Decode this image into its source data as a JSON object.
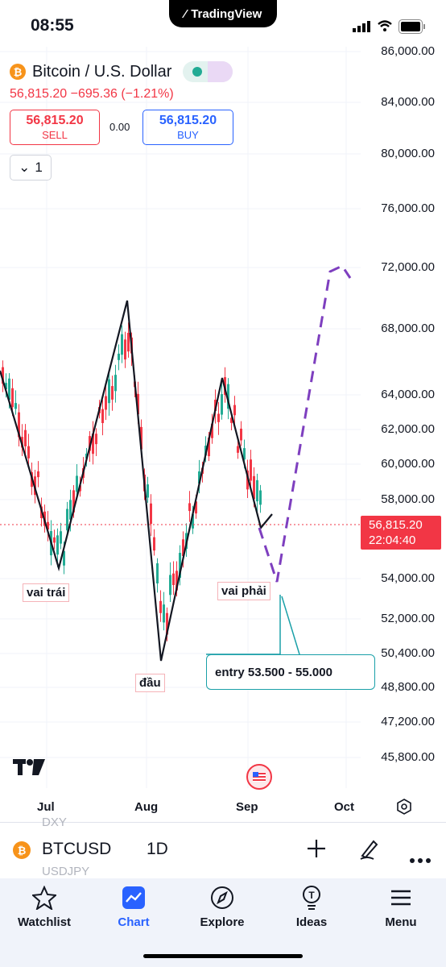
{
  "status_bar": {
    "time": "08:55",
    "app_pill": "TradingView"
  },
  "symbol": {
    "name": "Bitcoin / U.S. Dollar",
    "price_line": "56,815.20 −695.36 (−1.21%)",
    "sell_value": "56,815.20",
    "sell_label": "SELL",
    "spread": "0.00",
    "buy_value": "56,815.20",
    "buy_label": "BUY",
    "collapse_count": "1",
    "btc_glyph": "₿"
  },
  "y_axis": [
    {
      "label": "86,000.00",
      "value": 86000
    },
    {
      "label": "84,000.00",
      "value": 84000
    },
    {
      "label": "80,000.00",
      "value": 80000
    },
    {
      "label": "76,000.00",
      "value": 76000
    },
    {
      "label": "72,000.00",
      "value": 72000
    },
    {
      "label": "68,000.00",
      "value": 68000
    },
    {
      "label": "64,000.00",
      "value": 64000
    },
    {
      "label": "62,000.00",
      "value": 62000
    },
    {
      "label": "60,000.00",
      "value": 60000
    },
    {
      "label": "58,000.00",
      "value": 58000
    },
    {
      "label": "54,000.00",
      "value": 54000
    },
    {
      "label": "52,000.00",
      "value": 52000
    },
    {
      "label": "50,400.00",
      "value": 50400
    },
    {
      "label": "48,800.00",
      "value": 48800
    },
    {
      "label": "47,200.00",
      "value": 47200
    },
    {
      "label": "45,800.00",
      "value": 45800
    }
  ],
  "price_tag": {
    "price": "56,815.20",
    "countdown": "22:04:40"
  },
  "x_axis": [
    "Jul",
    "Aug",
    "Sep",
    "Oct"
  ],
  "annotations": {
    "left_shoulder": "vai trái",
    "head": "đầu",
    "right_shoulder": "vai phải",
    "entry": "entry 53.500 - 55.000"
  },
  "toolbar": {
    "ghost_top": "DXY",
    "ticker": "BTCUSD",
    "interval": "1D",
    "ghost_bottom": "USDJPY"
  },
  "tabs": [
    {
      "label": "Watchlist",
      "icon": "star-icon"
    },
    {
      "label": "Chart",
      "icon": "chart-icon"
    },
    {
      "label": "Explore",
      "icon": "compass-icon"
    },
    {
      "label": "Ideas",
      "icon": "lightbulb-icon"
    },
    {
      "label": "Menu",
      "icon": "menu-icon"
    }
  ],
  "colors": {
    "up": "#22ab94",
    "down": "#f23645",
    "accent": "#2962ff",
    "projection": "#7e3fbf",
    "entry_line": "#1aa0a8"
  }
}
